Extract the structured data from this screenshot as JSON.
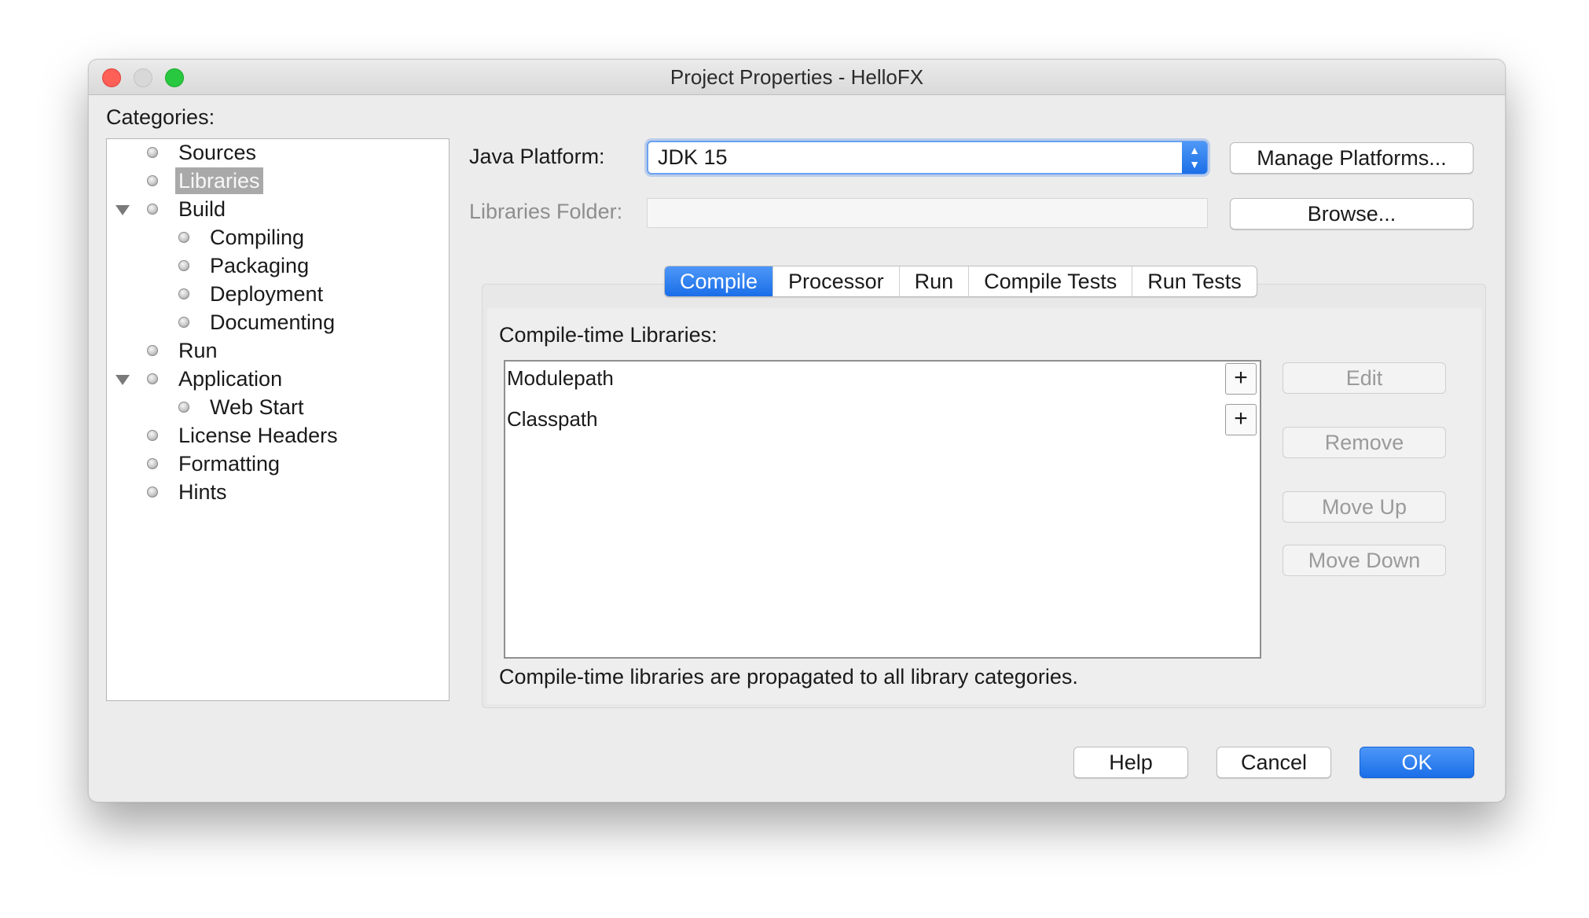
{
  "window": {
    "title": "Project Properties - HelloFX"
  },
  "categories": {
    "label": "Categories:",
    "items": [
      {
        "label": "Sources"
      },
      {
        "label": "Libraries",
        "selected": true
      },
      {
        "label": "Build",
        "expanded": true
      },
      {
        "label": "Compiling"
      },
      {
        "label": "Packaging"
      },
      {
        "label": "Deployment"
      },
      {
        "label": "Documenting"
      },
      {
        "label": "Run"
      },
      {
        "label": "Application",
        "expanded": true
      },
      {
        "label": "Web Start"
      },
      {
        "label": "License Headers"
      },
      {
        "label": "Formatting"
      },
      {
        "label": "Hints"
      }
    ]
  },
  "platform": {
    "label": "Java Platform:",
    "value": "JDK 15",
    "manage_label": "Manage Platforms..."
  },
  "libraries_folder": {
    "label": "Libraries Folder:",
    "value": "",
    "browse_label": "Browse..."
  },
  "tabs": [
    {
      "label": "Compile",
      "active": true
    },
    {
      "label": "Processor"
    },
    {
      "label": "Run"
    },
    {
      "label": "Compile Tests"
    },
    {
      "label": "Run Tests"
    }
  ],
  "compile": {
    "heading": "Compile-time Libraries:",
    "rows": [
      {
        "label": "Modulepath",
        "add": "+"
      },
      {
        "label": "Classpath",
        "add": "+"
      }
    ],
    "note": "Compile-time libraries are propagated to all library categories.",
    "actions": {
      "edit": "Edit",
      "remove": "Remove",
      "move_up": "Move Up",
      "move_down": "Move Down"
    }
  },
  "footer": {
    "help": "Help",
    "cancel": "Cancel",
    "ok": "OK"
  },
  "colors": {
    "accent": "#1a6ee8",
    "selection": "#a9a9a9",
    "close": "#fe5f57",
    "zoom": "#28c840"
  }
}
